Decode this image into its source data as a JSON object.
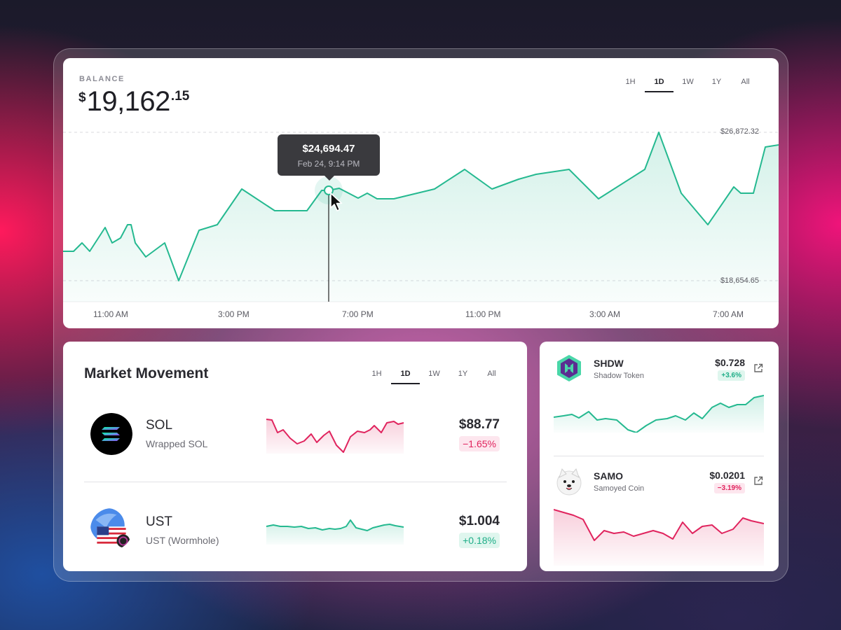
{
  "balance": {
    "label": "BALANCE",
    "currency": "$",
    "integer": "19,162",
    "decimals": ".15"
  },
  "main_ranges": [
    "1H",
    "1D",
    "1W",
    "1Y",
    "All"
  ],
  "main_active_range": "1D",
  "main_chart": {
    "grid_high": "$26,872.32",
    "grid_low": "$18,654.65",
    "x_labels": [
      "11:00 AM",
      "3:00 PM",
      "7:00 PM",
      "11:00 PM",
      "3:00 AM",
      "7:00 AM"
    ],
    "tooltip_value": "$24,694.47",
    "tooltip_date": "Feb 24, 9:14 PM",
    "line_color": "#25b990"
  },
  "market": {
    "title": "Market Movement",
    "ranges": [
      "1H",
      "1D",
      "1W",
      "1Y",
      "All"
    ],
    "active_range": "1D",
    "rows": [
      {
        "symbol": "SOL",
        "name": "Wrapped SOL",
        "price": "$88.77",
        "change": "−1.65%",
        "trend": "neg"
      },
      {
        "symbol": "UST",
        "name": "UST (Wormhole)",
        "price": "$1.004",
        "change": "+0.18%",
        "trend": "pos"
      }
    ]
  },
  "tokens": [
    {
      "symbol": "SHDW",
      "name": "Shadow Token",
      "price": "$0.728",
      "change": "+3.6%",
      "trend": "pos",
      "icon": "shadow-token-icon"
    },
    {
      "symbol": "SAMO",
      "name": "Samoyed Coin",
      "price": "$0.0201",
      "change": "−3.19%",
      "trend": "neg",
      "icon": "samoyed-dog-icon"
    }
  ],
  "colors": {
    "positive": "#25b990",
    "negative": "#e0245e"
  }
}
